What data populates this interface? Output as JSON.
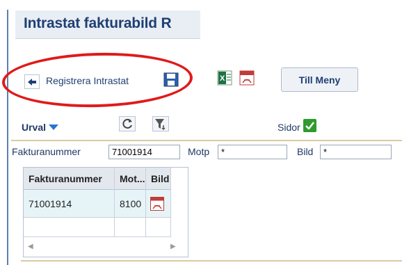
{
  "window": {
    "title": "Intrastat fakturabild R"
  },
  "toolbar": {
    "register_label": "Registrera Intrastat",
    "menu_label": "Till Meny",
    "icons": {
      "back": "arrow-left-icon",
      "save": "save-icon",
      "excel": "excel-icon",
      "pdf": "pdf-icon"
    }
  },
  "filter_bar": {
    "urval_label": "Urval",
    "sidor_label": "Sidor",
    "sidor_checked": true
  },
  "search": {
    "fakturanummer_label": "Fakturanummer",
    "fakturanummer_value": "71001914",
    "motp_label": "Motp",
    "motp_value": "*",
    "bild_label": "Bild",
    "bild_value": "*"
  },
  "table": {
    "columns": [
      "Fakturanummer",
      "Mot...",
      "Bild"
    ],
    "rows": [
      {
        "fakturanummer": "71001914",
        "motp": "8100",
        "bild_icon": "pdf-icon"
      }
    ]
  },
  "colors": {
    "accent": "#1f3f73",
    "highlight": "#e01a1a",
    "check": "#2e9b2e"
  }
}
